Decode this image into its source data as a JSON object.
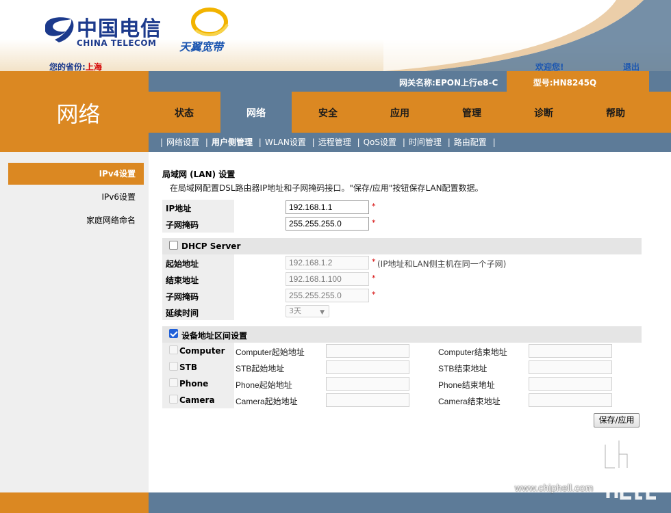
{
  "header": {
    "brand_cn": "中国电信",
    "brand_en": "CHINA TELECOM",
    "tianyi_brand": "天翼宽带",
    "province_label": "您的省份:",
    "province_value": "上海",
    "welcome": "欢迎您!",
    "logout": "退出",
    "gateway_name": "网关名称:EPON上行e8-C",
    "model": "型号:HN8245Q"
  },
  "section_title": "网络",
  "tabs": [
    {
      "label": "状态"
    },
    {
      "label": "网络",
      "active": true
    },
    {
      "label": "安全"
    },
    {
      "label": "应用"
    },
    {
      "label": "管理"
    },
    {
      "label": "诊断"
    },
    {
      "label": "帮助"
    }
  ],
  "subnav": [
    "网络设置",
    "用户侧管理",
    "WLAN设置",
    "远程管理",
    "QoS设置",
    "时间管理",
    "路由配置"
  ],
  "subnav_separator": "|",
  "sidebar": [
    "IPv4设置",
    "IPv6设置",
    "家庭网络命名"
  ],
  "lan": {
    "title": "局域网 (LAN) 设置",
    "desc": "在局域网配置DSL路由器IP地址和子网掩码接口。\"保存/应用\"按钮保存LAN配置数据。",
    "ip_label": "IP地址",
    "ip_value": "192.168.1.1",
    "mask_label": "子网掩码",
    "mask_value": "255.255.255.0"
  },
  "dhcp": {
    "label": "DHCP Server",
    "checked": false,
    "start_label": "起始地址",
    "start_value": "192.168.1.2",
    "start_hint": "(IP地址和LAN侧主机在同一个子网)",
    "end_label": "结束地址",
    "end_value": "192.168.1.100",
    "mask_label": "子网掩码",
    "mask_value": "255.255.255.0",
    "lease_label": "延续时间",
    "lease_value": "3天"
  },
  "device_range": {
    "label": "设备地址区间设置",
    "checked": true,
    "devices": [
      {
        "name": "Computer",
        "start_label": "Computer起始地址",
        "end_label": "Computer结束地址"
      },
      {
        "name": "STB",
        "start_label": "STB起始地址",
        "end_label": "STB结束地址"
      },
      {
        "name": "Phone",
        "start_label": "Phone起始地址",
        "end_label": "Phone结束地址"
      },
      {
        "name": "Camera",
        "start_label": "Camera起始地址",
        "end_label": "Camera结束地址"
      }
    ]
  },
  "required_mark": "*",
  "save_button": "保存/应用",
  "watermark": "www.chiphell.com",
  "colors": {
    "orange": "#db8822",
    "steel_blue": "#5d7b98",
    "telecom_blue": "#1c3a8c",
    "red": "#d40000"
  }
}
